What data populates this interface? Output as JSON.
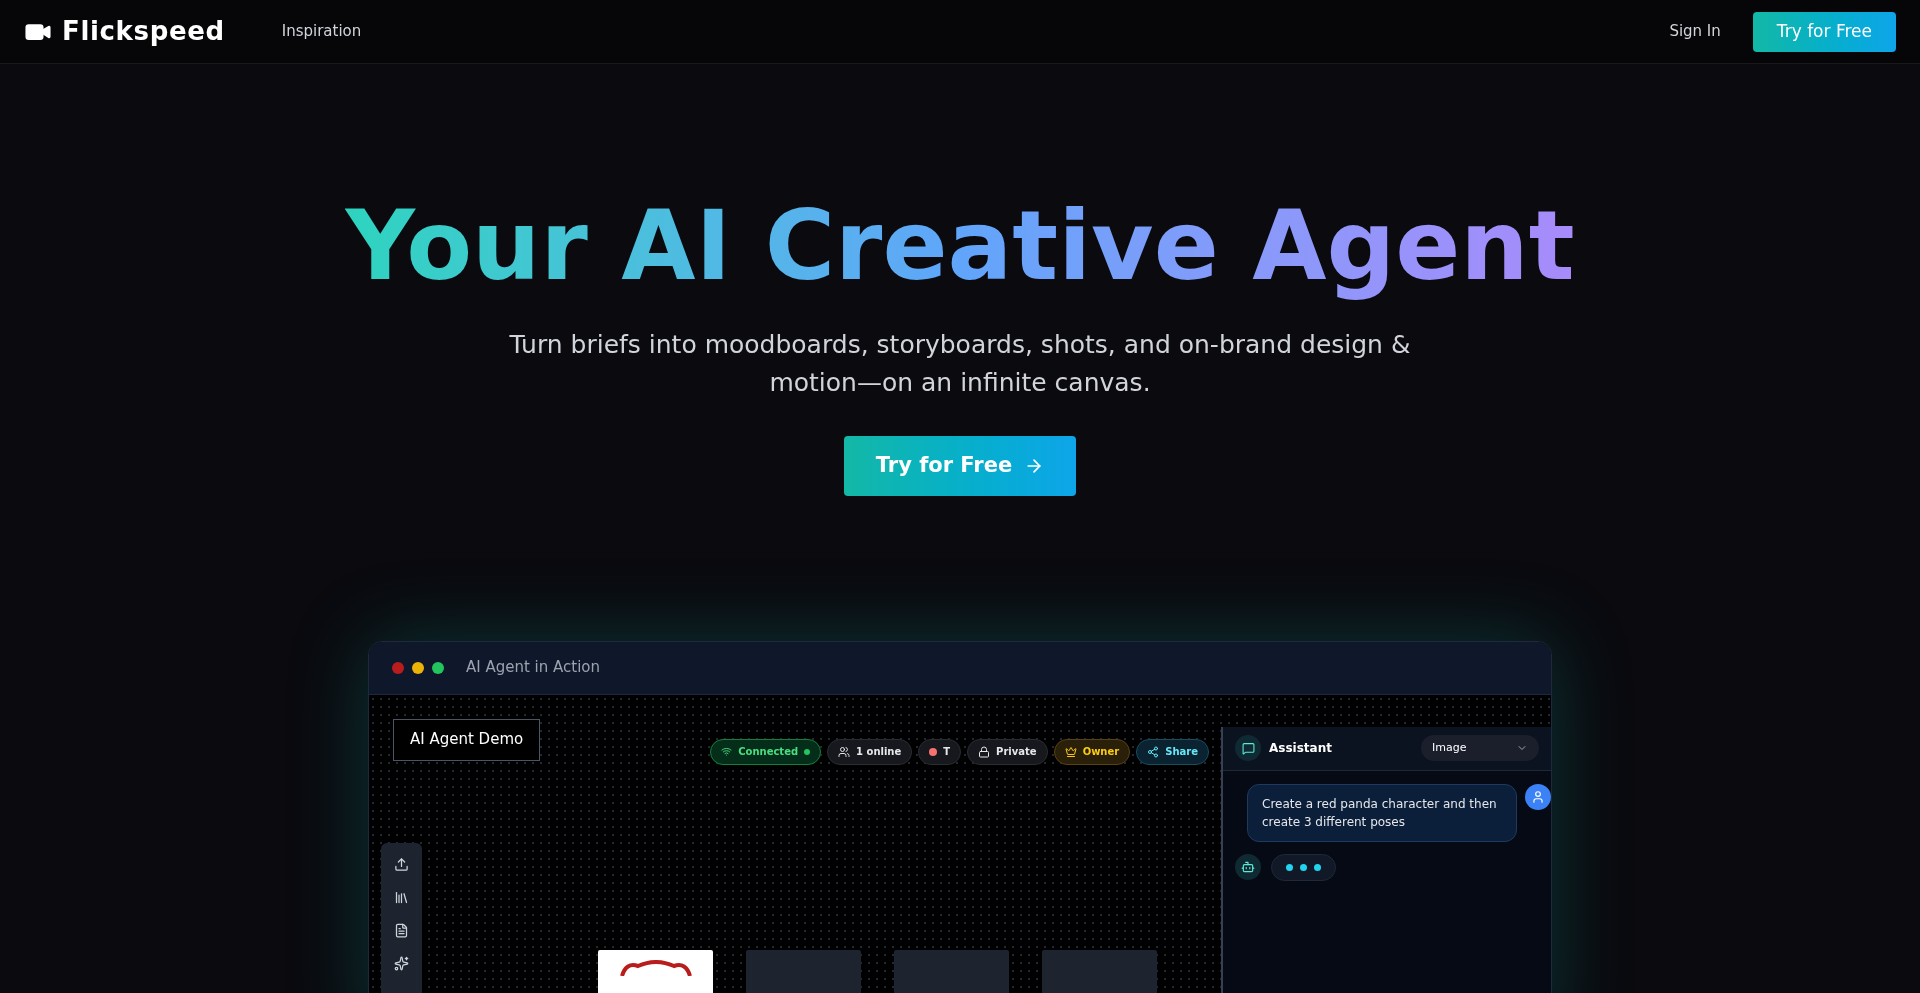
{
  "nav": {
    "brand": "Flickspeed",
    "links": [
      "Inspiration"
    ],
    "sign_in": "Sign In",
    "cta": "Try for Free"
  },
  "hero": {
    "title": "Your AI Creative Agent",
    "subtitle": "Turn briefs into moodboards, storyboards, shots, and on-brand design & motion—on an infinite canvas.",
    "cta": "Try for Free"
  },
  "demo": {
    "window_title": "AI Agent in Action",
    "board_title": "AI Agent Demo",
    "chips": [
      {
        "kind": "connected",
        "label": "Connected",
        "color": "#22c55e"
      },
      {
        "kind": "online",
        "label": "1 online"
      },
      {
        "kind": "user",
        "label": "T",
        "color": "#f87171"
      },
      {
        "kind": "private",
        "label": "Private"
      },
      {
        "kind": "owner",
        "label": "Owner"
      },
      {
        "kind": "share",
        "label": "Share"
      }
    ],
    "cards": [
      {
        "kind": "image"
      },
      {
        "kind": "empty"
      },
      {
        "kind": "empty"
      },
      {
        "kind": "empty"
      }
    ],
    "assistant": {
      "title": "Assistant",
      "mode": "Image",
      "message": "Create a red panda character and then create 3 different poses"
    }
  }
}
